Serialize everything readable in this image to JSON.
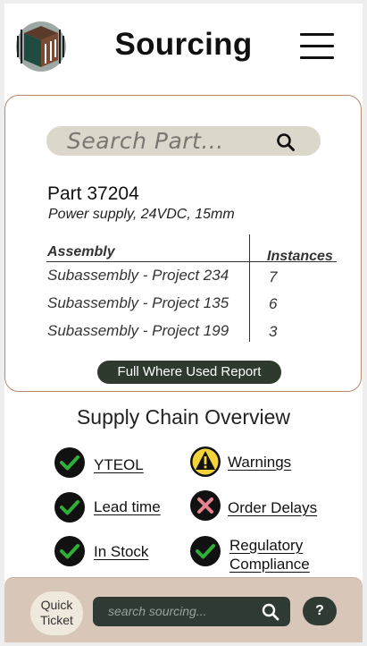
{
  "header": {
    "title": "Sourcing"
  },
  "search": {
    "placeholder": "Search Part..."
  },
  "part": {
    "title": "Part 37204",
    "description": "Power supply, 24VDC, 15mm"
  },
  "where_used": {
    "col_assembly": "Assembly",
    "col_instances": "Instances",
    "rows": [
      {
        "assembly": "Subassembly - Project 234",
        "instances": "7"
      },
      {
        "assembly": "Subassembly - Project 135",
        "instances": "6"
      },
      {
        "assembly": "Subassembly - Project 199",
        "instances": "3"
      }
    ],
    "report_button": "Full Where Used Report"
  },
  "supply_chain": {
    "title": "Supply Chain Overview",
    "items": [
      {
        "label": "YTEOL",
        "status": "ok",
        "icon": "check-icon"
      },
      {
        "label": "Warnings",
        "status": "warning",
        "icon": "warning-icon"
      },
      {
        "label": "Lead time",
        "status": "ok",
        "icon": "check-icon"
      },
      {
        "label": "Order Delays",
        "status": "error",
        "icon": "x-icon"
      },
      {
        "label": "In Stock",
        "status": "ok",
        "icon": "check-icon"
      },
      {
        "label_line1": "Regulatory",
        "label_line2": "Compliance",
        "status": "ok",
        "icon": "check-icon"
      }
    ]
  },
  "footer": {
    "quick_ticket_line1": "Quick",
    "quick_ticket_line2": "Ticket",
    "search_placeholder": "search sourcing...",
    "help_label": "?"
  },
  "colors": {
    "check_bg": "#111111",
    "check_mark": "#2fae3a",
    "warning_fill": "#f2d43a",
    "error_mark": "#e7838f",
    "footer_bg": "#d8c6b8",
    "dark_green": "#2f3a33",
    "search_pill": "#dcd7cb",
    "card_border": "#b9886a"
  }
}
